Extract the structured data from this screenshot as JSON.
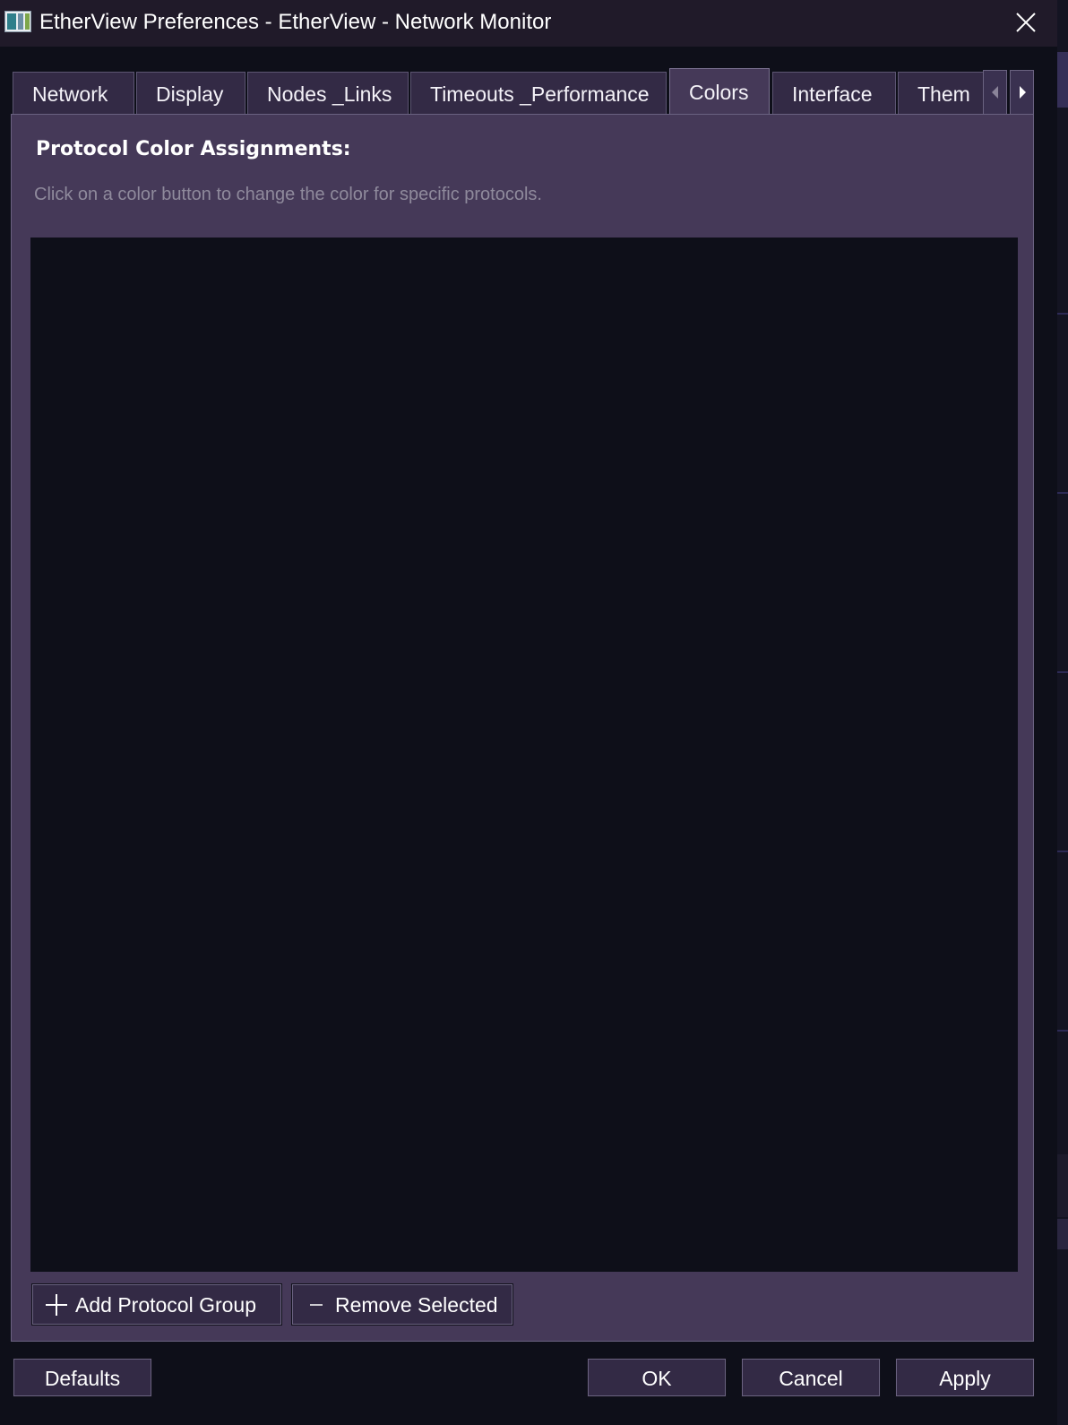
{
  "window": {
    "title": "EtherView Preferences - EtherView - Network Monitor",
    "icon": "app-window-icon",
    "close_icon": "close-icon"
  },
  "tabs": [
    {
      "label": "Network",
      "active": false
    },
    {
      "label": "Display",
      "active": false
    },
    {
      "label": "Nodes _Links",
      "active": false
    },
    {
      "label": "Timeouts _Performance",
      "active": false
    },
    {
      "label": "Colors",
      "active": true
    },
    {
      "label": "Interface",
      "active": false
    },
    {
      "label": "Them",
      "active": false
    }
  ],
  "tab_scroll": {
    "left_icon": "chevron-left-icon",
    "right_icon": "chevron-right-icon"
  },
  "colors_tab": {
    "heading": "Protocol Color Assignments:",
    "hint": "Click on a color button to change the color for specific protocols.",
    "add_button": {
      "label": "Add Protocol Group",
      "icon": "plus-icon"
    },
    "remove_button": {
      "label": "Remove Selected",
      "icon": "minus-icon"
    }
  },
  "footer": {
    "defaults_label": "Defaults",
    "ok_label": "OK",
    "cancel_label": "Cancel",
    "apply_label": "Apply"
  },
  "theme": {
    "background": "#0e0f19",
    "titlebar": "#201a29",
    "panel": "#453958",
    "tab": "#332a45",
    "hint_text": "#8f8a9c"
  }
}
